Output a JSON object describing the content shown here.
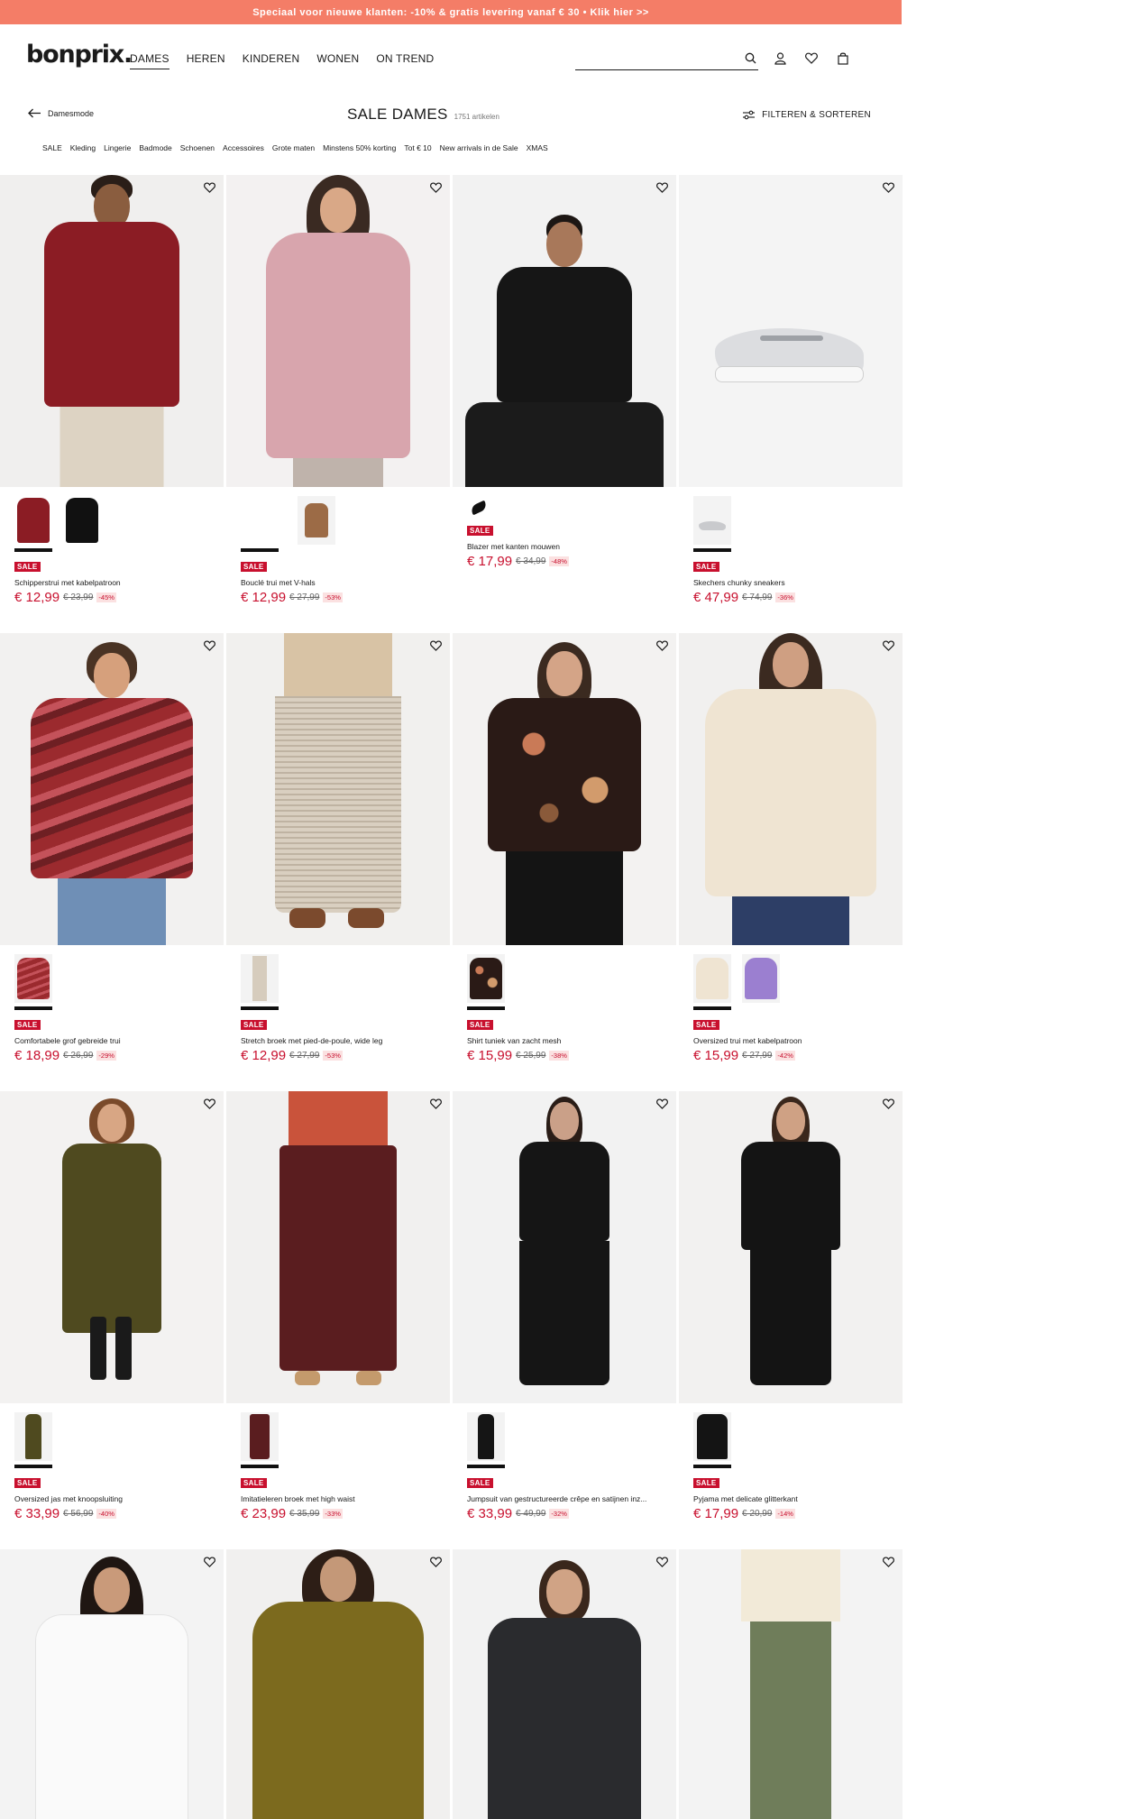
{
  "promo": "Speciaal voor nieuwe klanten: -10% & gratis levering vanaf € 30 • Klik hier >>",
  "logo": "bonprix.",
  "nav": [
    "DAMES",
    "HEREN",
    "KINDEREN",
    "WONEN",
    "ON TREND"
  ],
  "back_label": "Damesmode",
  "title": "SALE DAMES",
  "count": "1751 artikelen",
  "filter_label": "FILTEREN & SORTEREN",
  "subnav": [
    "SALE",
    "Kleding",
    "Lingerie",
    "Badmode",
    "Schoenen",
    "Accessoires",
    "Grote maten",
    "Minstens 50% korting",
    "Tot € 10",
    "New arrivals in de Sale",
    "XMAS"
  ],
  "sale_badge": "SALE",
  "products": [
    {
      "name": "Schipperstrui met kabelpatroon",
      "price": "€ 12,99",
      "old": "€ 23,99",
      "disc": "-45%"
    },
    {
      "name": "Bouclé trui met V-hals",
      "price": "€ 12,99",
      "old": "€ 27,99",
      "disc": "-53%"
    },
    {
      "name": "Blazer met kanten mouwen",
      "price": "€ 17,99",
      "old": "€ 34,99",
      "disc": "-48%"
    },
    {
      "name": "Skechers chunky sneakers",
      "price": "€ 47,99",
      "old": "€ 74,99",
      "disc": "-36%"
    },
    {
      "name": "Comfortabele grof gebreide trui",
      "price": "€ 18,99",
      "old": "€ 26,99",
      "disc": "-29%"
    },
    {
      "name": "Stretch broek met pied-de-poule, wide leg",
      "price": "€ 12,99",
      "old": "€ 27,99",
      "disc": "-53%"
    },
    {
      "name": "Shirt tuniek van zacht mesh",
      "price": "€ 15,99",
      "old": "€ 25,99",
      "disc": "-38%"
    },
    {
      "name": "Oversized trui met kabelpatroon",
      "price": "€ 15,99",
      "old": "€ 27,99",
      "disc": "-42%"
    },
    {
      "name": "Oversized jas met knoopsluiting",
      "price": "€ 33,99",
      "old": "€ 56,99",
      "disc": "-40%"
    },
    {
      "name": "Imitatieleren broek met high waist",
      "price": "€ 23,99",
      "old": "€ 35,99",
      "disc": "-33%"
    },
    {
      "name": "Jumpsuit van gestructureerde crêpe en satijnen inz...",
      "price": "€ 33,99",
      "old": "€ 49,99",
      "disc": "-32%"
    },
    {
      "name": "Pyjama met delicate glitterkant",
      "price": "€ 17,99",
      "old": "€ 20,99",
      "disc": "-14%"
    }
  ],
  "colors": {
    "promo": "#f47d67",
    "sale": "#c8102e"
  }
}
